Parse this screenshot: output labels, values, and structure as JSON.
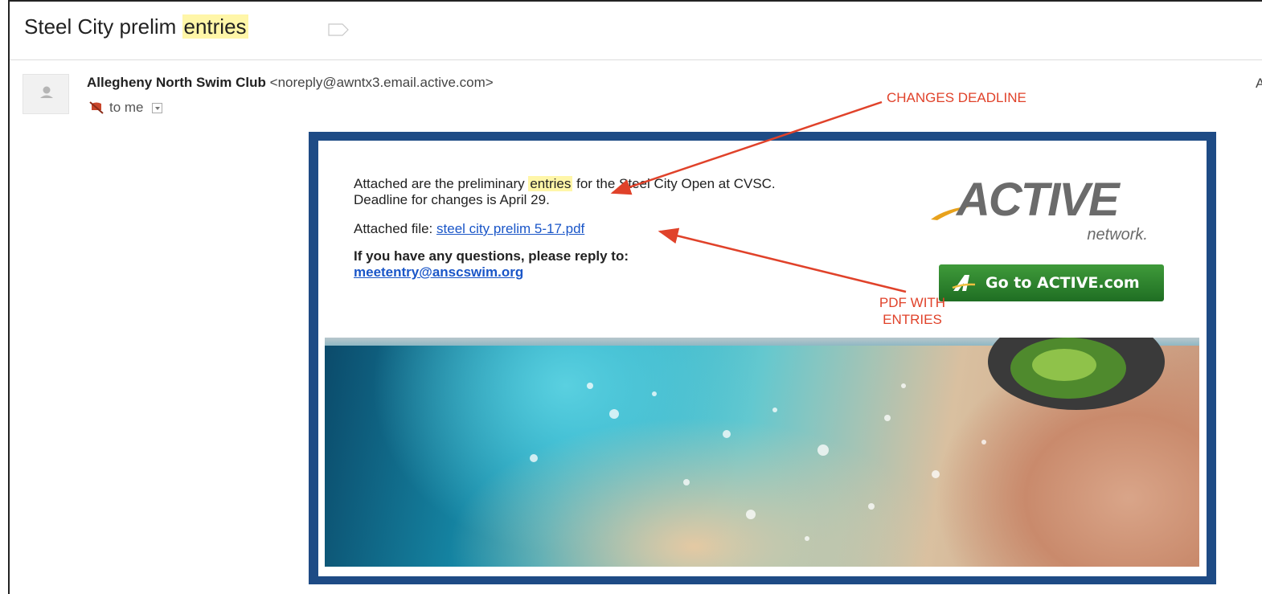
{
  "subject": {
    "before": "Steel City prelim ",
    "highlight": "entries"
  },
  "sender": {
    "name": "Allegheny North Swim Club",
    "email": "<noreply@awntx3.email.active.com>",
    "recipient": "to me",
    "cut_char": "A"
  },
  "body": {
    "line1_before": "Attached are the preliminary ",
    "line1_highlight": "entries",
    "line1_after": " for the Steel City Open at CVSC.",
    "line2": "Deadline for changes is April 29.",
    "attached_label": "Attached file: ",
    "attached_link": "steel city prelim 5-17.pdf",
    "questions": "If you have any questions, please reply to:",
    "reply_email": "meetentry@anscswim.org"
  },
  "logo": {
    "main": "ACTIVE",
    "sub": "network."
  },
  "button": {
    "label": "Go to ACTIVE.com"
  },
  "annotations": {
    "deadline": "CHANGES DEADLINE",
    "pdf_line1": "PDF WITH",
    "pdf_line2": "ENTRIES",
    "color": "#e0422a"
  },
  "colors": {
    "card_border": "#1e4b85",
    "link": "#1a56c8",
    "highlight": "#fff6a8",
    "button": "#2e8a2f"
  },
  "icons": [
    "label-tag-icon",
    "avatar-icon",
    "muted-icon",
    "dropdown-icon",
    "active-a-icon"
  ]
}
